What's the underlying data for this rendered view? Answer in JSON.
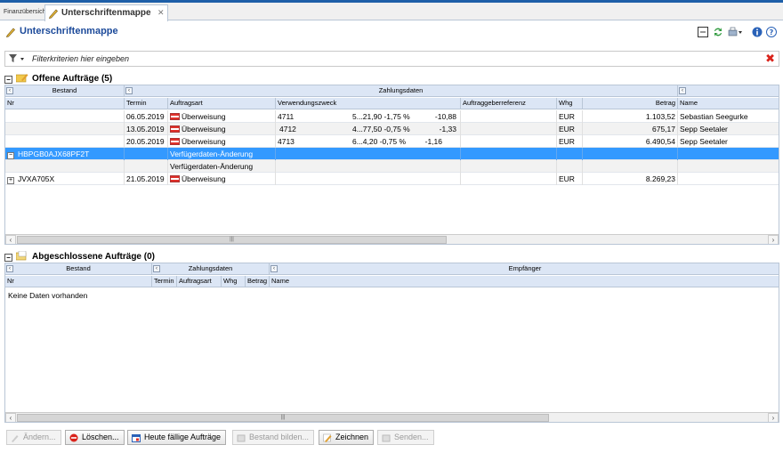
{
  "tabs": [
    {
      "label": "Finanzübersicht"
    },
    {
      "label": "Unterschriftenmappe"
    }
  ],
  "page": {
    "title": "Unterschriftenmappe"
  },
  "filter": {
    "placeholder": "Filterkriterien hier eingeben"
  },
  "open_section": {
    "title": "Offene Aufträge (5)",
    "group_headers": [
      "Bestand",
      "Zahlungsdaten"
    ],
    "columns": [
      "Nr",
      "Termin",
      "Auftragsart",
      "Verwendungszweck",
      "Auftraggeberreferenz",
      "Whg",
      "Betrag",
      "Name"
    ],
    "rows": [
      {
        "nr": "",
        "termin": "06.05.2019",
        "art": "Überweisung",
        "zweck": "4711",
        "zweck2": "5...21,90  -1,75 %",
        "zweck3": "-10,88",
        "ref": "",
        "whg": "EUR",
        "betrag": "1.103,52",
        "name": "Sebastian Seegurke"
      },
      {
        "nr": "",
        "termin": "13.05.2019",
        "art": "Überweisung",
        "zweck": "4712",
        "zweck2": "4...77,50  -0,75 %",
        "zweck3": "-1,33",
        "ref": "",
        "whg": "EUR",
        "betrag": "675,17",
        "name": "Sepp Seetaler"
      },
      {
        "nr": "",
        "termin": "20.05.2019",
        "art": "Überweisung",
        "zweck": "4713",
        "zweck2": "6...4,20  -0,75 %",
        "zweck3": "-1,16",
        "ref": "",
        "whg": "EUR",
        "betrag": "6.490,54",
        "name": "Sepp Seetaler"
      },
      {
        "nr": "HBPGB0AJX68PF2T",
        "termin": "",
        "art": "Verfügerdaten-Änderung",
        "zweck": "",
        "zweck2": "",
        "zweck3": "",
        "ref": "",
        "whg": "",
        "betrag": "",
        "name": ""
      },
      {
        "nr": "",
        "termin": "",
        "art": "Verfügerdaten-Änderung",
        "zweck": "",
        "zweck2": "",
        "zweck3": "",
        "ref": "",
        "whg": "",
        "betrag": "",
        "name": ""
      },
      {
        "nr": "JVXA705X",
        "termin": "21.05.2019",
        "art": "Überweisung",
        "zweck": "",
        "zweck2": "",
        "zweck3": "",
        "ref": "",
        "whg": "EUR",
        "betrag": "8.269,23",
        "name": ""
      }
    ]
  },
  "closed_section": {
    "title": "Abgeschlossene Aufträge (0)",
    "group_headers": [
      "Bestand",
      "Zahlungsdaten",
      "Empfänger"
    ],
    "columns": [
      "Nr",
      "Termin",
      "Auftragsart",
      "Whg",
      "Betrag",
      "Name"
    ],
    "empty_text": "Keine Daten vorhanden"
  },
  "buttons": {
    "edit": "Ändern...",
    "delete": "Löschen...",
    "due_today": "Heute fällige Aufträge",
    "build": "Bestand bilden...",
    "sign": "Zeichnen",
    "send": "Senden..."
  },
  "colors": {
    "accent": "#1c4a9a",
    "selection": "#3399ff",
    "header_bg": "#dce6f5",
    "close_red": "#d9231b"
  }
}
